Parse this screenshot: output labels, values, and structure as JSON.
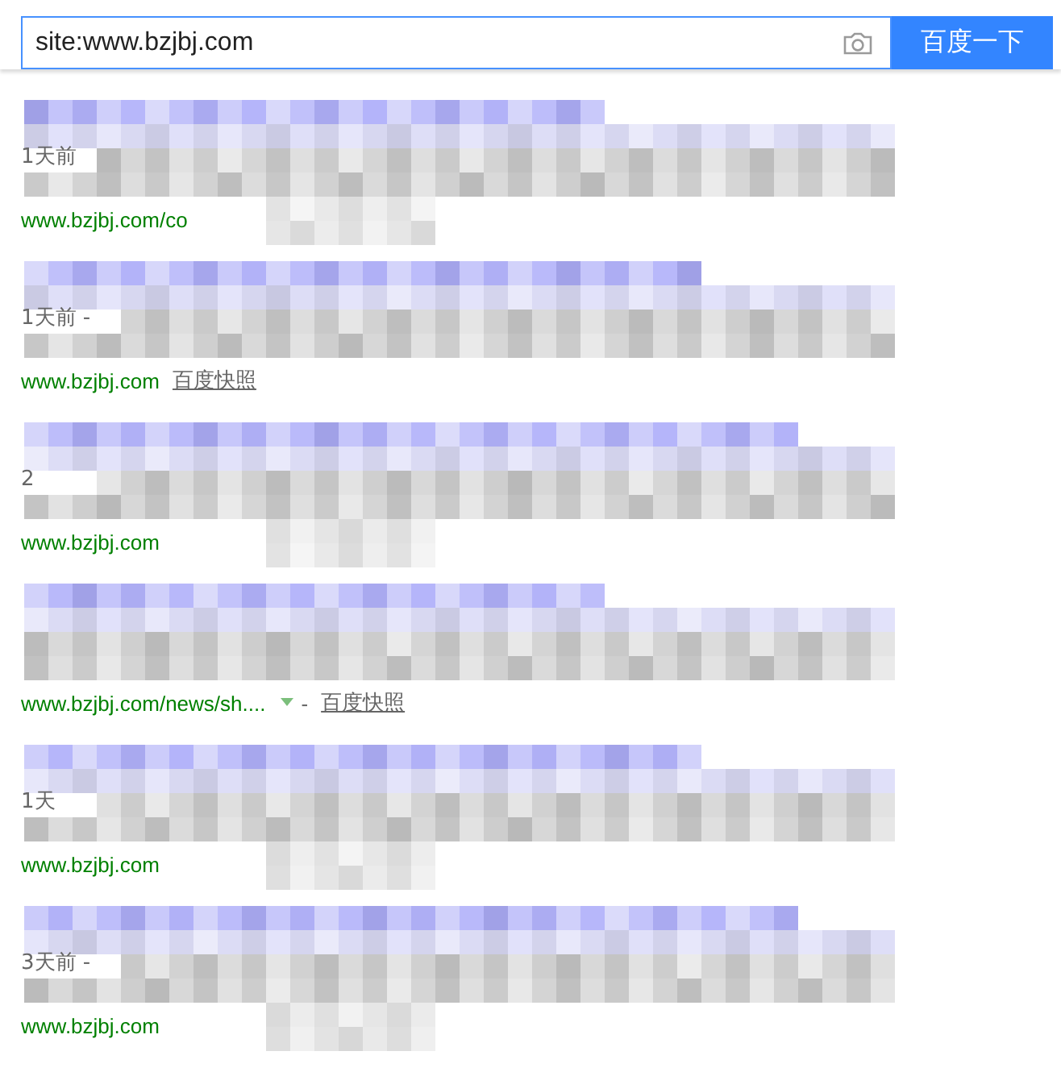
{
  "search": {
    "query": "site:www.bzjbj.com",
    "button": "百度一下"
  },
  "results": [
    {
      "date": "1天前",
      "url": "www.bzjbj.com/co"
    },
    {
      "date": "1天前 -",
      "url": "www.bzjbj.com",
      "snapshot": "百度快照"
    },
    {
      "date": "2",
      "url": "www.bzjbj.com"
    },
    {
      "url": "www.bzjbj.com/news/sh....",
      "separator": "-",
      "snapshot": "百度快照"
    },
    {
      "date": "1天",
      "url": "www.bzjbj.com"
    },
    {
      "date": "3天前 -",
      "url": "www.bzjbj.com"
    }
  ]
}
